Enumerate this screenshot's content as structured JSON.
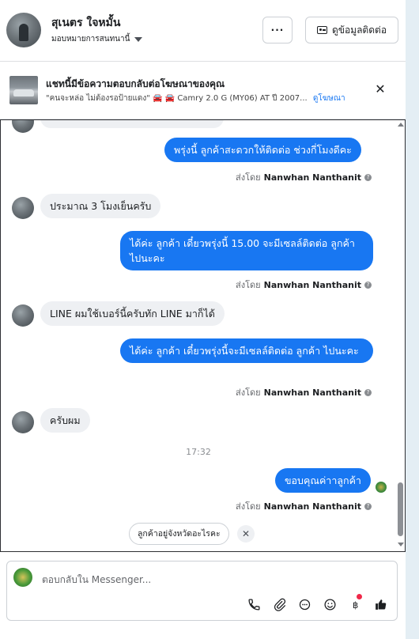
{
  "header": {
    "contact_name": "สุเนตร ใจหมั้น",
    "assign_label": "มอบหมายการสนทนานี้",
    "more_label": "···",
    "contact_button_label": "ดูข้อมูลติดต่อ"
  },
  "ad_banner": {
    "title": "แชทนี้มีข้อความตอบกลับต่อโฆษณาของคุณ",
    "subtitle": "\"คนจะหล่อ ไม่ต้องรอป้ายแดง\" 🚘 🚘 Camry 2.0 G (MY06) AT ปี 2007...",
    "link": "ดูโฆษณา",
    "close": "✕"
  },
  "conversation": {
    "sent_by_prefix": "ส่งโดย",
    "agent_name": "Nanwhan Nanthanit",
    "messages": [
      {
        "dir": "out",
        "text": "พรุ่งนี้ ลูกค้าสะดวกให้ติดต่อ ช่วงกี่โมงดีคะ"
      },
      {
        "dir": "in",
        "text": "ประมาณ 3 โมงเย็นครับ"
      },
      {
        "dir": "out",
        "text": "ได้ค่ะ  ลูกค้า เดี๋ยวพรุ่งนี้ 15.00 จะมีเซลล์ติดต่อ ลูกค้า ไปนะคะ"
      },
      {
        "dir": "in",
        "text": "LINE ผมใช้เบอร์นี้ครับทัก LINE มาก็ได้"
      },
      {
        "dir": "out",
        "text": "ได้ค่ะ  ลูกค้า เดี๋ยวพรุ่งนี้จะมีเซลล์ติดต่อ ลูกค้า ไปนะคะ"
      },
      {
        "dir": "in",
        "text": "ครับผม"
      },
      {
        "dir": "out",
        "text": "ขอบคุณค่าาลูกค้า"
      }
    ],
    "timestamp": "17:32",
    "suggested_reply": "ลูกค้าอยู่จังหวัดอะไรคะ",
    "suggested_close": "✕"
  },
  "composer": {
    "placeholder": "ตอบกลับใน Messenger...",
    "tools": [
      "phone-icon",
      "attachment-icon",
      "chat-bubble-icon",
      "emoji-icon",
      "baht-icon",
      "like-icon"
    ]
  },
  "colors": {
    "accent": "#1877f2",
    "incoming_bubble": "#eef0f3",
    "notification_dot": "#f02849"
  }
}
